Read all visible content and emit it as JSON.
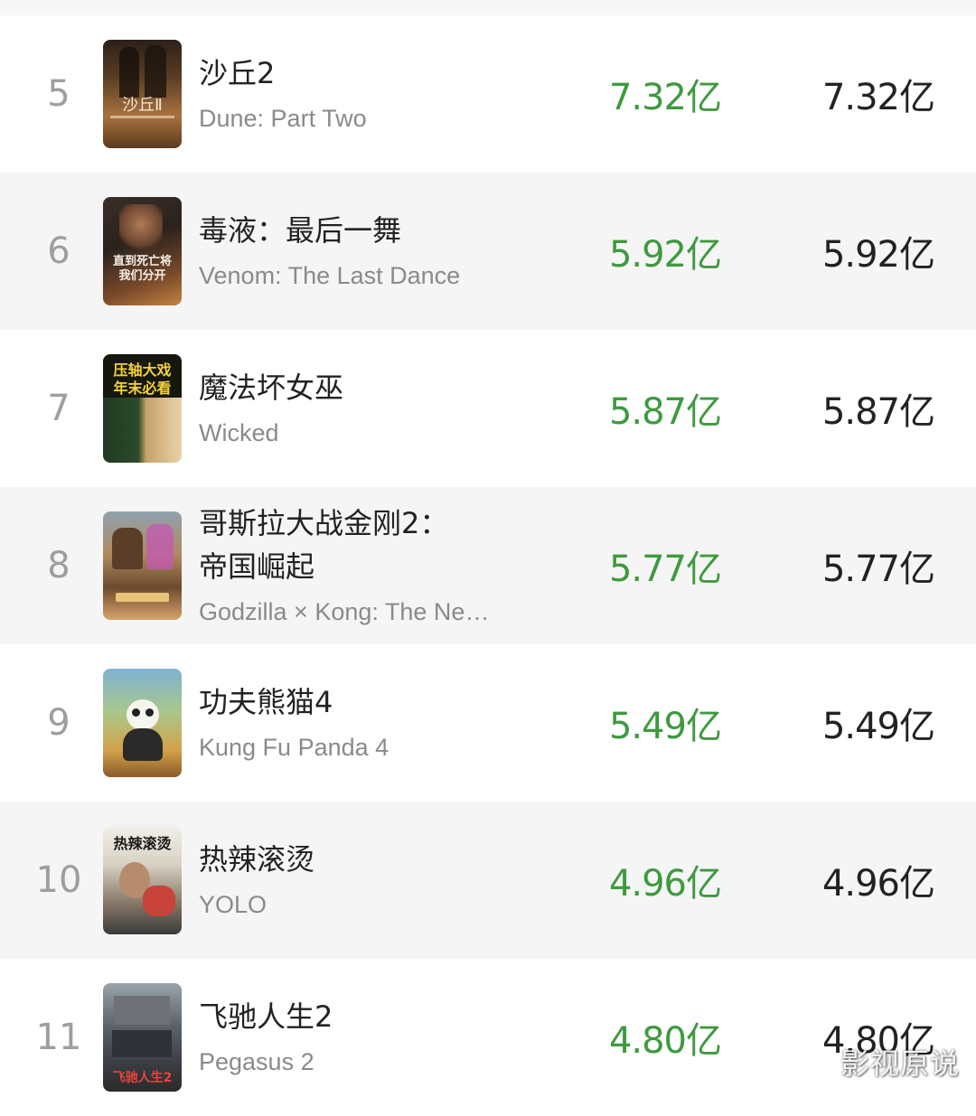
{
  "movies": [
    {
      "rank": "5",
      "title_cn": "沙丘2",
      "title_en": "Dune: Part Two",
      "gross_primary": "7.32亿",
      "gross_secondary": "7.32亿",
      "poster_icon": "dune-poster",
      "poster_colors": [
        "#3b2a1c",
        "#c08a55"
      ],
      "poster_text": "沙丘Ⅱ"
    },
    {
      "rank": "6",
      "title_cn": "毒液：最后一舞",
      "title_en": "Venom: The Last Dance",
      "gross_primary": "5.92亿",
      "gross_secondary": "5.92亿",
      "poster_icon": "venom-poster",
      "poster_colors": [
        "#2a2522",
        "#b8703a"
      ],
      "poster_text": "直到死亡将我们分开"
    },
    {
      "rank": "7",
      "title_cn": "魔法坏女巫",
      "title_en": "Wicked",
      "gross_primary": "5.87亿",
      "gross_secondary": "5.87亿",
      "poster_icon": "wicked-poster",
      "poster_colors": [
        "#16301b",
        "#c9a35a"
      ],
      "poster_text": "压轴大戏年末必看"
    },
    {
      "rank": "8",
      "title_cn": "哥斯拉大战金刚2：帝国崛起",
      "title_en": "Godzilla × Kong: The New Empire",
      "gross_primary": "5.77亿",
      "gross_secondary": "5.77亿",
      "poster_icon": "godzilla-kong-poster",
      "poster_colors": [
        "#6b5a45",
        "#d3a06a"
      ],
      "poster_text": ""
    },
    {
      "rank": "9",
      "title_cn": "功夫熊猫4",
      "title_en": "Kung Fu Panda 4",
      "gross_primary": "5.49亿",
      "gross_secondary": "5.49亿",
      "poster_icon": "kung-fu-panda-poster",
      "poster_colors": [
        "#6fa6c9",
        "#c88a3a"
      ],
      "poster_text": ""
    },
    {
      "rank": "10",
      "title_cn": "热辣滚烫",
      "title_en": "YOLO",
      "gross_primary": "4.96亿",
      "gross_secondary": "4.96亿",
      "poster_icon": "yolo-poster",
      "poster_colors": [
        "#3a3a3a",
        "#c8433a"
      ],
      "poster_text": "热辣滚烫"
    },
    {
      "rank": "11",
      "title_cn": "飞驰人生2",
      "title_en": "Pegasus 2",
      "gross_primary": "4.80亿",
      "gross_secondary": "4.80亿",
      "poster_icon": "pegasus-poster",
      "poster_colors": [
        "#4a4d52",
        "#c83a2a"
      ],
      "poster_text": "飞驰人生2"
    }
  ],
  "watermark": "影视原说",
  "colors": {
    "gross_green": "#3e9a3e",
    "text_dark": "#222222",
    "text_gray": "#8a8a8a",
    "rank_gray": "#9e9e9e"
  }
}
